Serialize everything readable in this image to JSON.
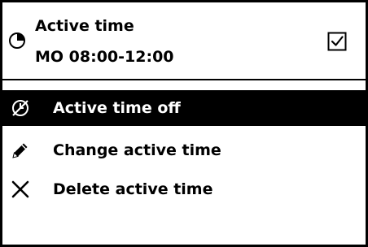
{
  "header": {
    "title": "Active time",
    "subtitle": "MO 08:00-12:00",
    "leading_icon": "clock-icon",
    "checkbox_checked": true
  },
  "menu": {
    "items": [
      {
        "label": "Active time off",
        "icon": "clock-off-icon",
        "selected": true
      },
      {
        "label": "Change active time",
        "icon": "pencil-icon",
        "selected": false
      },
      {
        "label": "Delete active time",
        "icon": "close-icon",
        "selected": false
      }
    ]
  },
  "colors": {
    "background": "#ffffff",
    "foreground": "#000000",
    "selected_background": "#000000",
    "selected_foreground": "#ffffff"
  }
}
